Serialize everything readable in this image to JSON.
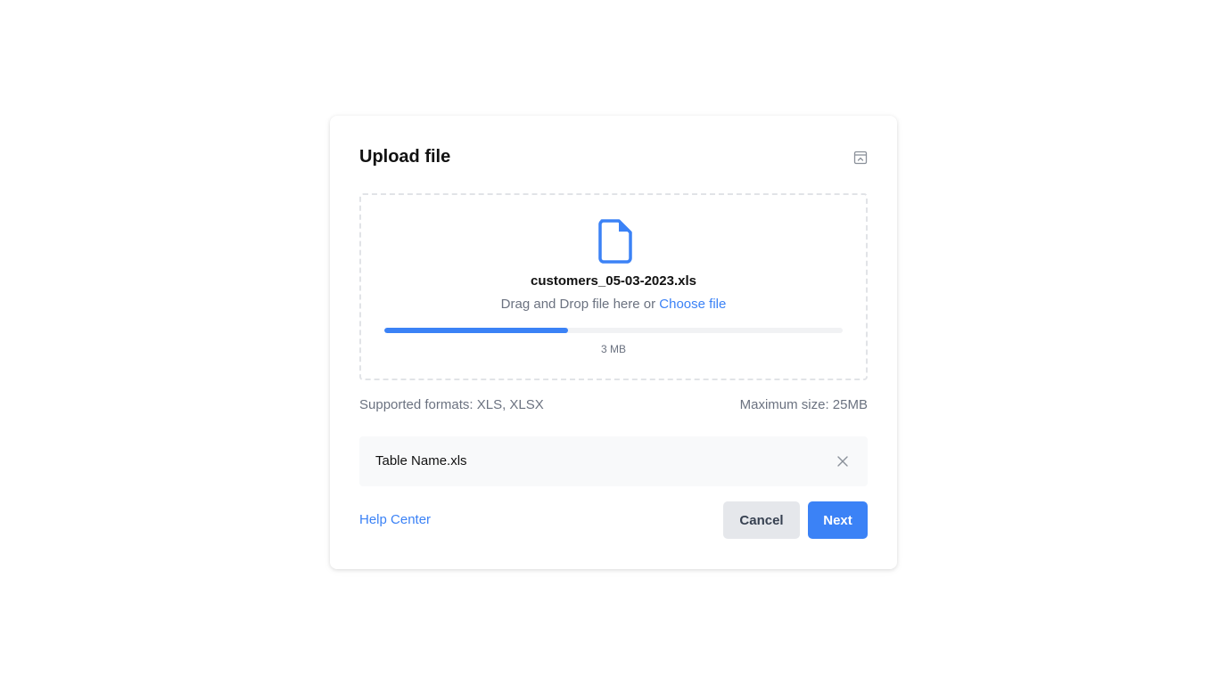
{
  "dialog": {
    "title": "Upload file",
    "minimize_icon": "minimize-window-icon"
  },
  "dropzone": {
    "icon": "file-icon",
    "file_name": "customers_05-03-2023.xls",
    "drag_text": "Drag and Drop file here or",
    "choose_link": "Choose file",
    "progress_percent": 40,
    "size_text": "3 MB"
  },
  "info": {
    "formats": "Supported formats: XLS, XLSX",
    "max_size": "Maximum size: 25MB"
  },
  "uploaded_file": {
    "name": "Table Name.xls",
    "remove_icon": "close-icon"
  },
  "footer": {
    "help_label": "Help Center",
    "cancel_label": "Cancel",
    "next_label": "Next"
  },
  "colors": {
    "accent": "#3b82f6",
    "muted_text": "#6b7280",
    "cancel_bg": "#e5e7eb",
    "row_bg": "#f8f9fa"
  }
}
